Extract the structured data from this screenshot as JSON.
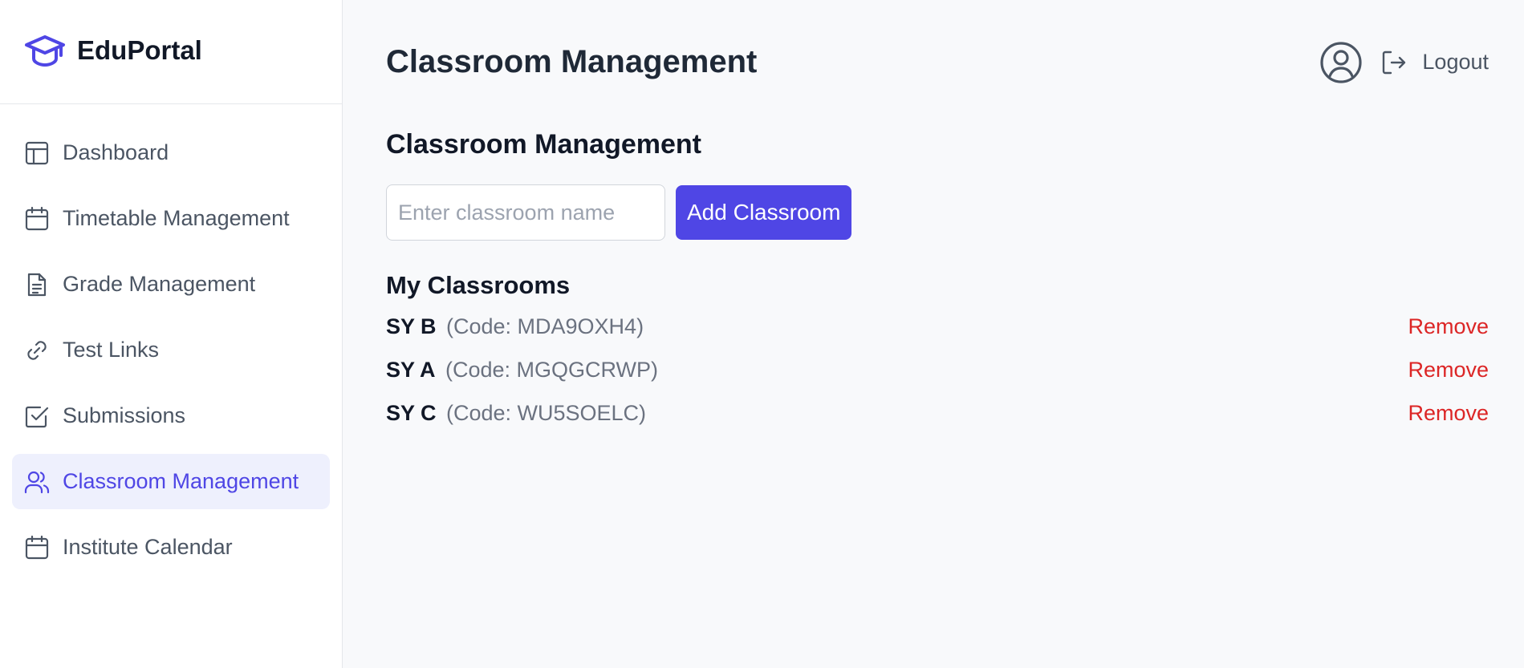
{
  "brand": {
    "name": "EduPortal",
    "icon": "graduation-cap-icon",
    "color": "#4f46e5"
  },
  "sidebar": {
    "items": [
      {
        "label": "Dashboard",
        "icon": "layout-icon",
        "active": false
      },
      {
        "label": "Timetable Management",
        "icon": "calendar-icon",
        "active": false
      },
      {
        "label": "Grade Management",
        "icon": "document-icon",
        "active": false
      },
      {
        "label": "Test Links",
        "icon": "link-icon",
        "active": false
      },
      {
        "label": "Submissions",
        "icon": "checkbox-icon",
        "active": false
      },
      {
        "label": "Classroom Management",
        "icon": "users-icon",
        "active": true
      },
      {
        "label": "Institute Calendar",
        "icon": "calendar-icon",
        "active": false
      }
    ]
  },
  "header": {
    "title": "Classroom Management",
    "user_icon": "user-circle-icon",
    "logout_label": "Logout"
  },
  "main": {
    "section_title": "Classroom Management",
    "input": {
      "value": "",
      "placeholder": "Enter classroom name"
    },
    "add_button_label": "Add Classroom",
    "list_title": "My Classrooms",
    "classrooms": [
      {
        "name": "SY B",
        "code": "(Code: MDA9OXH4)",
        "action": "Remove"
      },
      {
        "name": "SY A",
        "code": "(Code: MGQGCRWP)",
        "action": "Remove"
      },
      {
        "name": "SY C",
        "code": "(Code: WU5SOELC)",
        "action": "Remove"
      }
    ]
  },
  "colors": {
    "accent": "#4f46e5",
    "danger": "#dc2626",
    "active_bg": "#eef0fd"
  }
}
